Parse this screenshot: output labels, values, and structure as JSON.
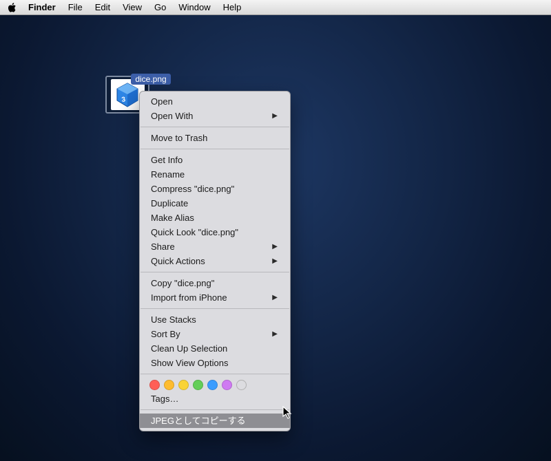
{
  "menubar": {
    "app": "Finder",
    "items": [
      "File",
      "Edit",
      "View",
      "Go",
      "Window",
      "Help"
    ]
  },
  "icon": {
    "filename": "dice.png"
  },
  "context_menu": {
    "groups": [
      [
        {
          "label": "Open",
          "submenu": false
        },
        {
          "label": "Open With",
          "submenu": true
        }
      ],
      [
        {
          "label": "Move to Trash",
          "submenu": false
        }
      ],
      [
        {
          "label": "Get Info",
          "submenu": false
        },
        {
          "label": "Rename",
          "submenu": false
        },
        {
          "label": "Compress \"dice.png\"",
          "submenu": false
        },
        {
          "label": "Duplicate",
          "submenu": false
        },
        {
          "label": "Make Alias",
          "submenu": false
        },
        {
          "label": "Quick Look \"dice.png\"",
          "submenu": false
        },
        {
          "label": "Share",
          "submenu": true
        },
        {
          "label": "Quick Actions",
          "submenu": true
        }
      ],
      [
        {
          "label": "Copy \"dice.png\"",
          "submenu": false
        },
        {
          "label": "Import from iPhone",
          "submenu": true
        }
      ],
      [
        {
          "label": "Use Stacks",
          "submenu": false
        },
        {
          "label": "Sort By",
          "submenu": true
        },
        {
          "label": "Clean Up Selection",
          "submenu": false
        },
        {
          "label": "Show View Options",
          "submenu": false
        }
      ]
    ],
    "tags_label": "Tags…",
    "tag_colors": [
      "#ff5f57",
      "#febc2e",
      "#f9d335",
      "#63ce58",
      "#3a9dff",
      "#cf7af2"
    ],
    "highlighted": "JPEGとしてコピーする"
  }
}
